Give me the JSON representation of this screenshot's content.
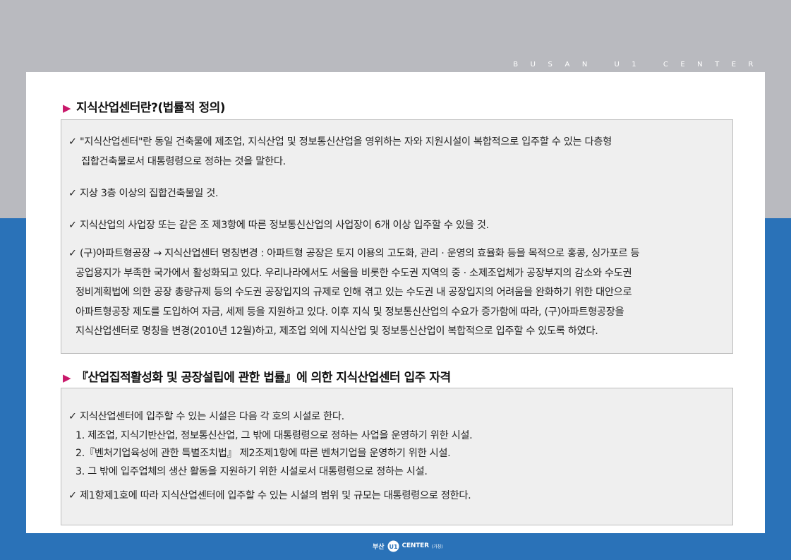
{
  "brand_top": "BUSAN U1 CENTER",
  "section1": {
    "marker": "▶",
    "title": "지식산업센터란?(법률적 정의)",
    "items": [
      {
        "check": "✓",
        "lines": [
          "\"지식산업센터\"란 동일 건축물에 제조업, 지식산업 및 정보통신산업을 영위하는 자와 지원시설이 복합적으로 입주할 수 있는 다층형",
          "집합건축물로서 대통령령으로 정하는 것을 말한다."
        ]
      },
      {
        "check": "✓",
        "lines": [
          "지상 3층 이상의 집합건축물일 것."
        ]
      },
      {
        "check": "✓",
        "lines": [
          "지식산업의 사업장 또는 같은 조 제3항에 따른 정보통신산업의 사업장이 6개 이상 입주할 수 있을 것."
        ]
      },
      {
        "check": "✓",
        "lines": [
          "(구)아파트형공장 → 지식산업센터 명칭변경 : 아파트형 공장은 토지 이용의 고도화, 관리 · 운영의 효율화 등을 목적으로 홍콩, 싱가포르 등",
          "공업용지가 부족한 국가에서 활성화되고 있다. 우리나라에서도 서울을 비롯한 수도권 지역의 중 · 소제조업체가 공장부지의 감소와 수도권",
          "정비계획법에 의한 공장 총량규제 등의 수도권 공장입지의 규제로 인해 겪고 있는 수도권 내 공장입지의 어려움을 완화하기 위한 대안으로",
          "아파트형공장 제도를 도입하여 자금, 세제 등을 지원하고 있다. 이후 지식 및 정보통신산업의 수요가 증가함에 따라, (구)아파트형공장을",
          "지식산업센터로 명칭을 변경(2010년 12월)하고, 제조업 외에 지식산업 및 정보통신산업이 복합적으로 입주할 수 있도록 하였다."
        ]
      }
    ]
  },
  "section2": {
    "marker": "▶",
    "title": "『산업집적활성화 및 공장설립에 관한 법률』에 의한 지식산업센터 입주 자격",
    "item1": {
      "check": "✓",
      "text": "지식산업센터에 입주할 수 있는 시설은 다음 각 호의 시설로 한다.",
      "subitems": [
        "1. 제조업, 지식기반산업, 정보통신산업, 그 밖에 대통령령으로 정하는 사업을 운영하기 위한 시설.",
        "2.『벤처기업육성에 관한 특별조치법』 제2조제1항에 따른 벤처기업을 운영하기 위한 시설.",
        "3. 그 밖에 입주업체의 생산 활동을 지원하기 위한 시설로서 대통령령으로 정하는 시설."
      ]
    },
    "item2": {
      "check": "✓",
      "text": "제1항제1호에 따라 지식산업센터에 입주할 수 있는 시설의 범위 및 규모는 대통령령으로 정한다."
    }
  },
  "footer": {
    "prefix": "부산",
    "logo_mark": "U1",
    "name": "CENTER",
    "suffix": "(가칭)"
  },
  "colors": {
    "top_band": "#b9babf",
    "bottom_band": "#2a72b8",
    "marker": "#c8186a",
    "box_bg": "#efefef"
  }
}
